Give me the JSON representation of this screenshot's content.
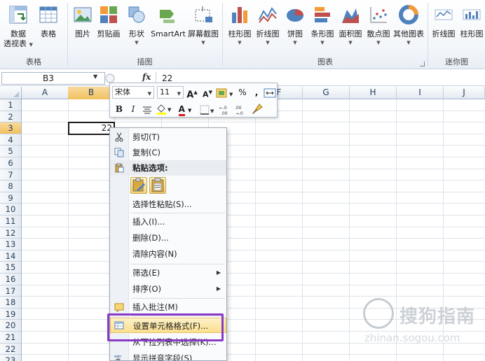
{
  "ribbon": {
    "groups": [
      {
        "label": "表格",
        "buttons": [
          {
            "label": "数据",
            "label2": "透视表",
            "dropdown": true
          },
          {
            "label": "表格"
          }
        ]
      },
      {
        "label": "插图",
        "buttons": [
          {
            "label": "图片"
          },
          {
            "label": "剪贴画"
          },
          {
            "label": "形状"
          },
          {
            "label": "SmartArt"
          },
          {
            "label": "屏幕截图"
          }
        ]
      },
      {
        "label": "图表",
        "buttons": [
          {
            "label": "柱形图"
          },
          {
            "label": "折线图"
          },
          {
            "label": "饼图"
          },
          {
            "label": "条形图"
          },
          {
            "label": "面积图"
          },
          {
            "label": "散点图"
          },
          {
            "label": "其他图表"
          }
        ]
      },
      {
        "label": "迷你图",
        "buttons": [
          {
            "label": "折线图"
          },
          {
            "label": "柱形图"
          }
        ]
      }
    ]
  },
  "formula_bar": {
    "name_box": "B3",
    "fx": "fx",
    "value": "22"
  },
  "grid": {
    "columns": [
      "A",
      "B",
      "C",
      "D",
      "E",
      "F",
      "G",
      "H",
      "I",
      "J"
    ],
    "rows": [
      "1",
      "2",
      "3",
      "4",
      "5",
      "6",
      "7",
      "8",
      "9",
      "10",
      "11",
      "12",
      "13",
      "14",
      "15",
      "16",
      "17",
      "18",
      "19",
      "20",
      "21",
      "22",
      "23"
    ],
    "active_cell": {
      "ref": "B3",
      "value": "22"
    }
  },
  "mini_toolbar": {
    "font": "宋体",
    "size": "11",
    "grow": "A",
    "shrink": "A",
    "percent": "%",
    "comma": ",",
    "bold": "B",
    "italic": "I",
    "font_color": "A"
  },
  "context_menu": {
    "items": [
      {
        "label": "剪切(T)",
        "icon": "scissors-icon"
      },
      {
        "label": "复制(C)",
        "icon": "copy-icon"
      },
      {
        "label": "粘贴选项:",
        "icon": "paste-icon",
        "header": true
      },
      {
        "label": "选择性粘贴(S)..."
      },
      {
        "label": "插入(I)..."
      },
      {
        "label": "删除(D)..."
      },
      {
        "label": "清除内容(N)"
      },
      {
        "label": "筛选(E)",
        "submenu": true
      },
      {
        "label": "排序(O)",
        "submenu": true
      },
      {
        "label": "插入批注(M)",
        "icon": "comment-icon"
      },
      {
        "label": "设置单元格格式(F)...",
        "icon": "format-cells-icon",
        "highlight": true
      },
      {
        "label": "从下拉列表中选择(K)..."
      },
      {
        "label": "显示拼音字段(S)",
        "icon": "phonetic-icon"
      }
    ]
  },
  "watermark": {
    "text": "搜狗指南",
    "url": "zhinan.sogou.com"
  },
  "colors": {
    "highlight_border": "#8a3bc6",
    "menu_highlight": "#fbdf8d",
    "header_active": "#f1c15f"
  }
}
